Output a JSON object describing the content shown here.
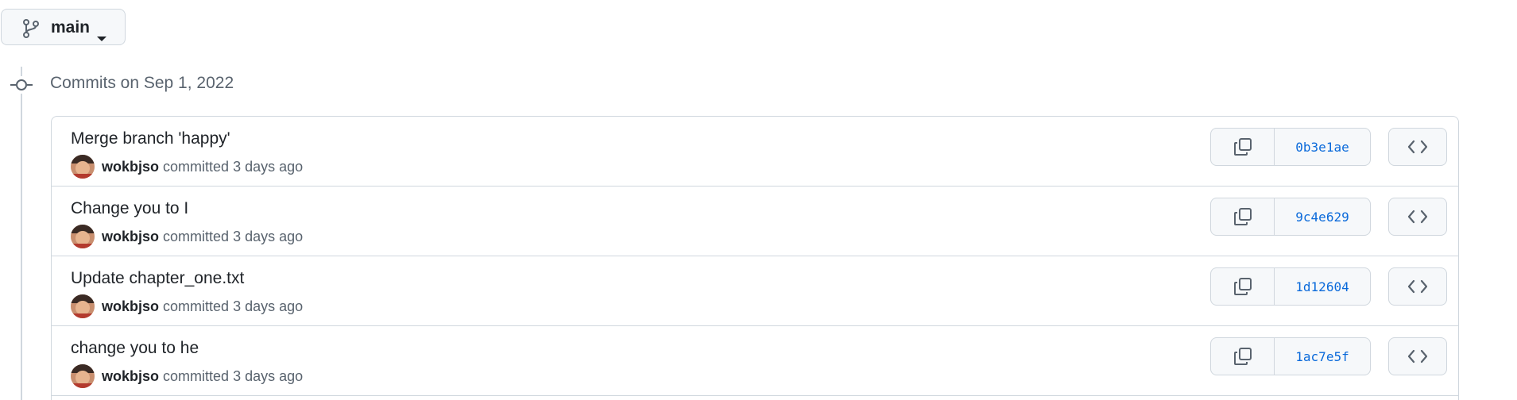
{
  "branch": {
    "label": "main",
    "icon": "git-branch-icon",
    "caret_icon": "triangle-down-icon"
  },
  "timeline": {
    "node_icon": "git-commit-icon",
    "group_title": "Commits on Sep 1, 2022"
  },
  "commits": [
    {
      "title": "Merge branch 'happy'",
      "author": "wokbjso",
      "action": "committed",
      "time": "3 days ago",
      "sha": "0b3e1ae"
    },
    {
      "title": "Change you to I",
      "author": "wokbjso",
      "action": "committed",
      "time": "3 days ago",
      "sha": "9c4e629"
    },
    {
      "title": "Update chapter_one.txt",
      "author": "wokbjso",
      "action": "committed",
      "time": "3 days ago",
      "sha": "1d12604"
    },
    {
      "title": "change you to he",
      "author": "wokbjso",
      "action": "committed",
      "time": "3 days ago",
      "sha": "1ac7e5f"
    }
  ],
  "icons": {
    "copy": "copy-icon",
    "browse": "code-icon"
  },
  "colors": {
    "link": "#0969da",
    "border": "#d0d7de",
    "button_bg": "#f6f8fa",
    "muted_text": "#59636e"
  }
}
